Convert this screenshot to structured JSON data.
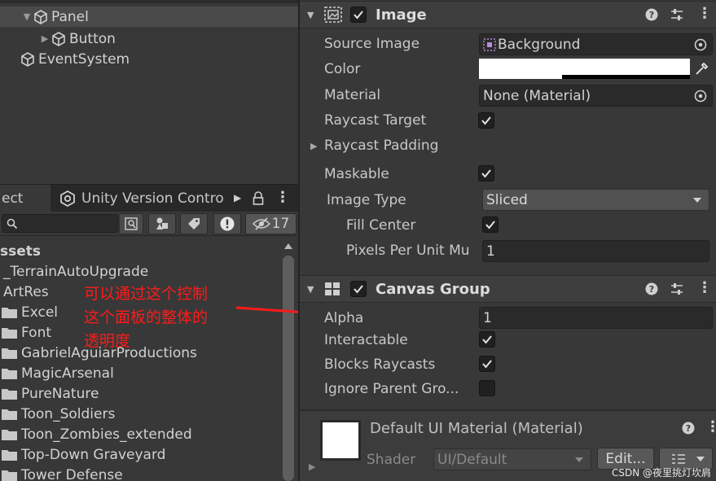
{
  "hierarchy": {
    "items": [
      {
        "label": "Panel",
        "selected": true
      },
      {
        "label": "Button"
      },
      {
        "label": "EventSystem"
      }
    ]
  },
  "project": {
    "tabs": [
      {
        "label": "ect"
      },
      {
        "label": "Unity Version Contro"
      }
    ],
    "hidden_count": "17",
    "tree": [
      {
        "label": "ssets"
      },
      {
        "label": "_TerrainAutoUpgrade"
      },
      {
        "label": "ArtRes"
      },
      {
        "label": "Excel"
      },
      {
        "label": "Font"
      },
      {
        "label": "GabrielAguiarProductions"
      },
      {
        "label": "MagicArsenal"
      },
      {
        "label": "PureNature"
      },
      {
        "label": "Toon_Soldiers"
      },
      {
        "label": "Toon_Zombies_extended"
      },
      {
        "label": "Top-Down Graveyard"
      },
      {
        "label": "Tower Defense"
      }
    ]
  },
  "annotation": {
    "lines": [
      "可以通过这个控制",
      "这个面板的整体的",
      "透明度"
    ],
    "color": "#ff1a1a"
  },
  "image_component": {
    "title": "Image",
    "enabled": true,
    "source_image_label": "Source Image",
    "source_image_value": "Background",
    "color_label": "Color",
    "material_label": "Material",
    "material_value": "None (Material)",
    "raycast_target_label": "Raycast Target",
    "raycast_target": true,
    "raycast_padding_label": "Raycast Padding",
    "maskable_label": "Maskable",
    "maskable": true,
    "image_type_label": "Image Type",
    "image_type_value": "Sliced",
    "fill_center_label": "Fill Center",
    "fill_center": true,
    "ppu_label": "Pixels Per Unit Mu",
    "ppu_value": "1"
  },
  "canvas_group": {
    "title": "Canvas Group",
    "enabled": true,
    "alpha_label": "Alpha",
    "alpha_value": "1",
    "interactable_label": "Interactable",
    "interactable": true,
    "blocks_raycasts_label": "Blocks Raycasts",
    "blocks_raycasts": true,
    "ignore_parent_label": "Ignore Parent Gro...",
    "ignore_parent": false
  },
  "material_section": {
    "title": "Default UI Material (Material)",
    "shader_label": "Shader",
    "shader_value": "UI/Default",
    "edit_label": "Edit..."
  },
  "watermark": "CSDN @夜里挑灯坎肩",
  "colors": {
    "accent_text": "#c8c8c8",
    "panel_bg": "#383838",
    "field_bg": "#2a2a2a",
    "annotation": "#ff1a1a"
  }
}
